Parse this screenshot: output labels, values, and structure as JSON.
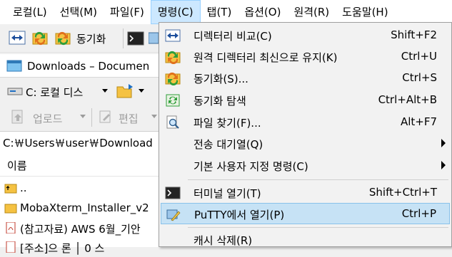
{
  "menubar": {
    "items": [
      "로컬(L)",
      "선택(M)",
      "파일(F)",
      "명령(C)",
      "탭(T)",
      "옵션(O)",
      "원격(R)",
      "도움말(H)"
    ]
  },
  "toolbar": {
    "sync_label": "동기화"
  },
  "tab": {
    "label": "Downloads – Documen"
  },
  "drive": {
    "label": "C: 로컬 디스"
  },
  "actions": {
    "upload": "업로드",
    "edit": "편집"
  },
  "path": {
    "text": "C:￦Users￦user￦Download"
  },
  "list": {
    "header": "이름",
    "rows": [
      {
        "name": ".."
      },
      {
        "name": "MobaXterm_Installer_v2"
      },
      {
        "name": "(참고자료) AWS 6월_기안"
      },
      {
        "name": "[주소]으    론 │ 0     스"
      }
    ]
  },
  "command_menu": {
    "items": [
      {
        "label": "디렉터리 비교(C)",
        "shortcut": "Shift+F2",
        "icon": "compare-icon"
      },
      {
        "label": "원격 디렉터리 최신으로 유지(K)",
        "shortcut": "Ctrl+U",
        "icon": "keep-remote-icon"
      },
      {
        "label": "동기화(S)...",
        "shortcut": "Ctrl+S",
        "icon": "synchronize-icon"
      },
      {
        "label": "동기화 탐색",
        "shortcut": "Ctrl+Alt+B",
        "icon": "sync-browse-icon"
      },
      {
        "label": "파일 찾기(F)...",
        "shortcut": "Alt+F7",
        "icon": "find-files-icon"
      },
      {
        "label": "전송 대기열(Q)",
        "shortcut": "",
        "icon": ""
      },
      {
        "label": "기본 사용자 지정 명령(C)",
        "shortcut": "",
        "icon": ""
      },
      {
        "label": "터미널 열기(T)",
        "shortcut": "Shift+Ctrl+T",
        "icon": "terminal-icon"
      },
      {
        "label": "PuTTY에서 열기(P)",
        "shortcut": "Ctrl+P",
        "icon": "putty-icon"
      },
      {
        "label": "캐시 삭제(R)",
        "shortcut": "",
        "icon": ""
      }
    ]
  }
}
